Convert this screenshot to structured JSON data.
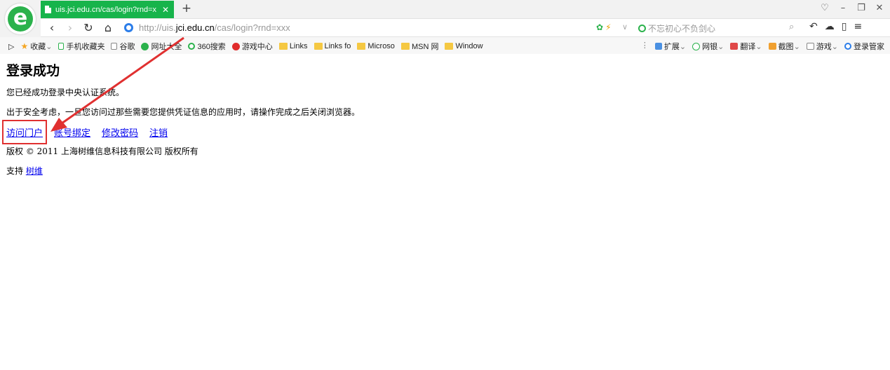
{
  "browser": {
    "tab_title": "uis.jci.edu.cn/cas/login?rnd=x",
    "address": {
      "prefix": "http://uis.",
      "domain": "jci.edu.cn",
      "path": "/cas/login?rnd=xxx"
    },
    "search_placeholder": "不忘初心不负剑心",
    "bookmarks": [
      {
        "label": "收藏",
        "icon": "star-icon"
      },
      {
        "label": "手机收藏夹",
        "icon": "phone-icon"
      },
      {
        "label": "谷歌",
        "icon": "page-icon"
      },
      {
        "label": "网址大全",
        "icon": "globe-icon"
      },
      {
        "label": "360搜索",
        "icon": "360-icon"
      },
      {
        "label": "游戏中心",
        "icon": "game-icon"
      },
      {
        "label": "Links",
        "icon": "folder-icon"
      },
      {
        "label": "Links fo",
        "icon": "folder-icon"
      },
      {
        "label": "Microso",
        "icon": "folder-icon"
      },
      {
        "label": "MSN 网",
        "icon": "folder-icon"
      },
      {
        "label": "Window",
        "icon": "folder-icon"
      }
    ],
    "right_tools": [
      {
        "label": "扩展",
        "icon": "extension-icon"
      },
      {
        "label": "网银",
        "icon": "bank-icon"
      },
      {
        "label": "翻译",
        "icon": "translate-icon"
      },
      {
        "label": "截图",
        "icon": "screenshot-icon"
      },
      {
        "label": "游戏",
        "icon": "games-icon"
      },
      {
        "label": "登录管家",
        "icon": "login-manager-icon"
      }
    ]
  },
  "page": {
    "heading": "登录成功",
    "message1": "您已经成功登录中央认证系统。",
    "message2": "出于安全考虑，一旦您访问过那些需要您提供凭证信息的应用时，请操作完成之后关闭浏览器。",
    "links": {
      "portal": "访问门户",
      "bind": "账号绑定",
      "password": "修改密码",
      "logout": "注销"
    },
    "copyright": "版权 © 2011 上海树维信息科技有限公司 版权所有",
    "support_label": "支持",
    "support_link": "树维"
  },
  "annotation": {
    "highlight_color": "#e03030"
  }
}
